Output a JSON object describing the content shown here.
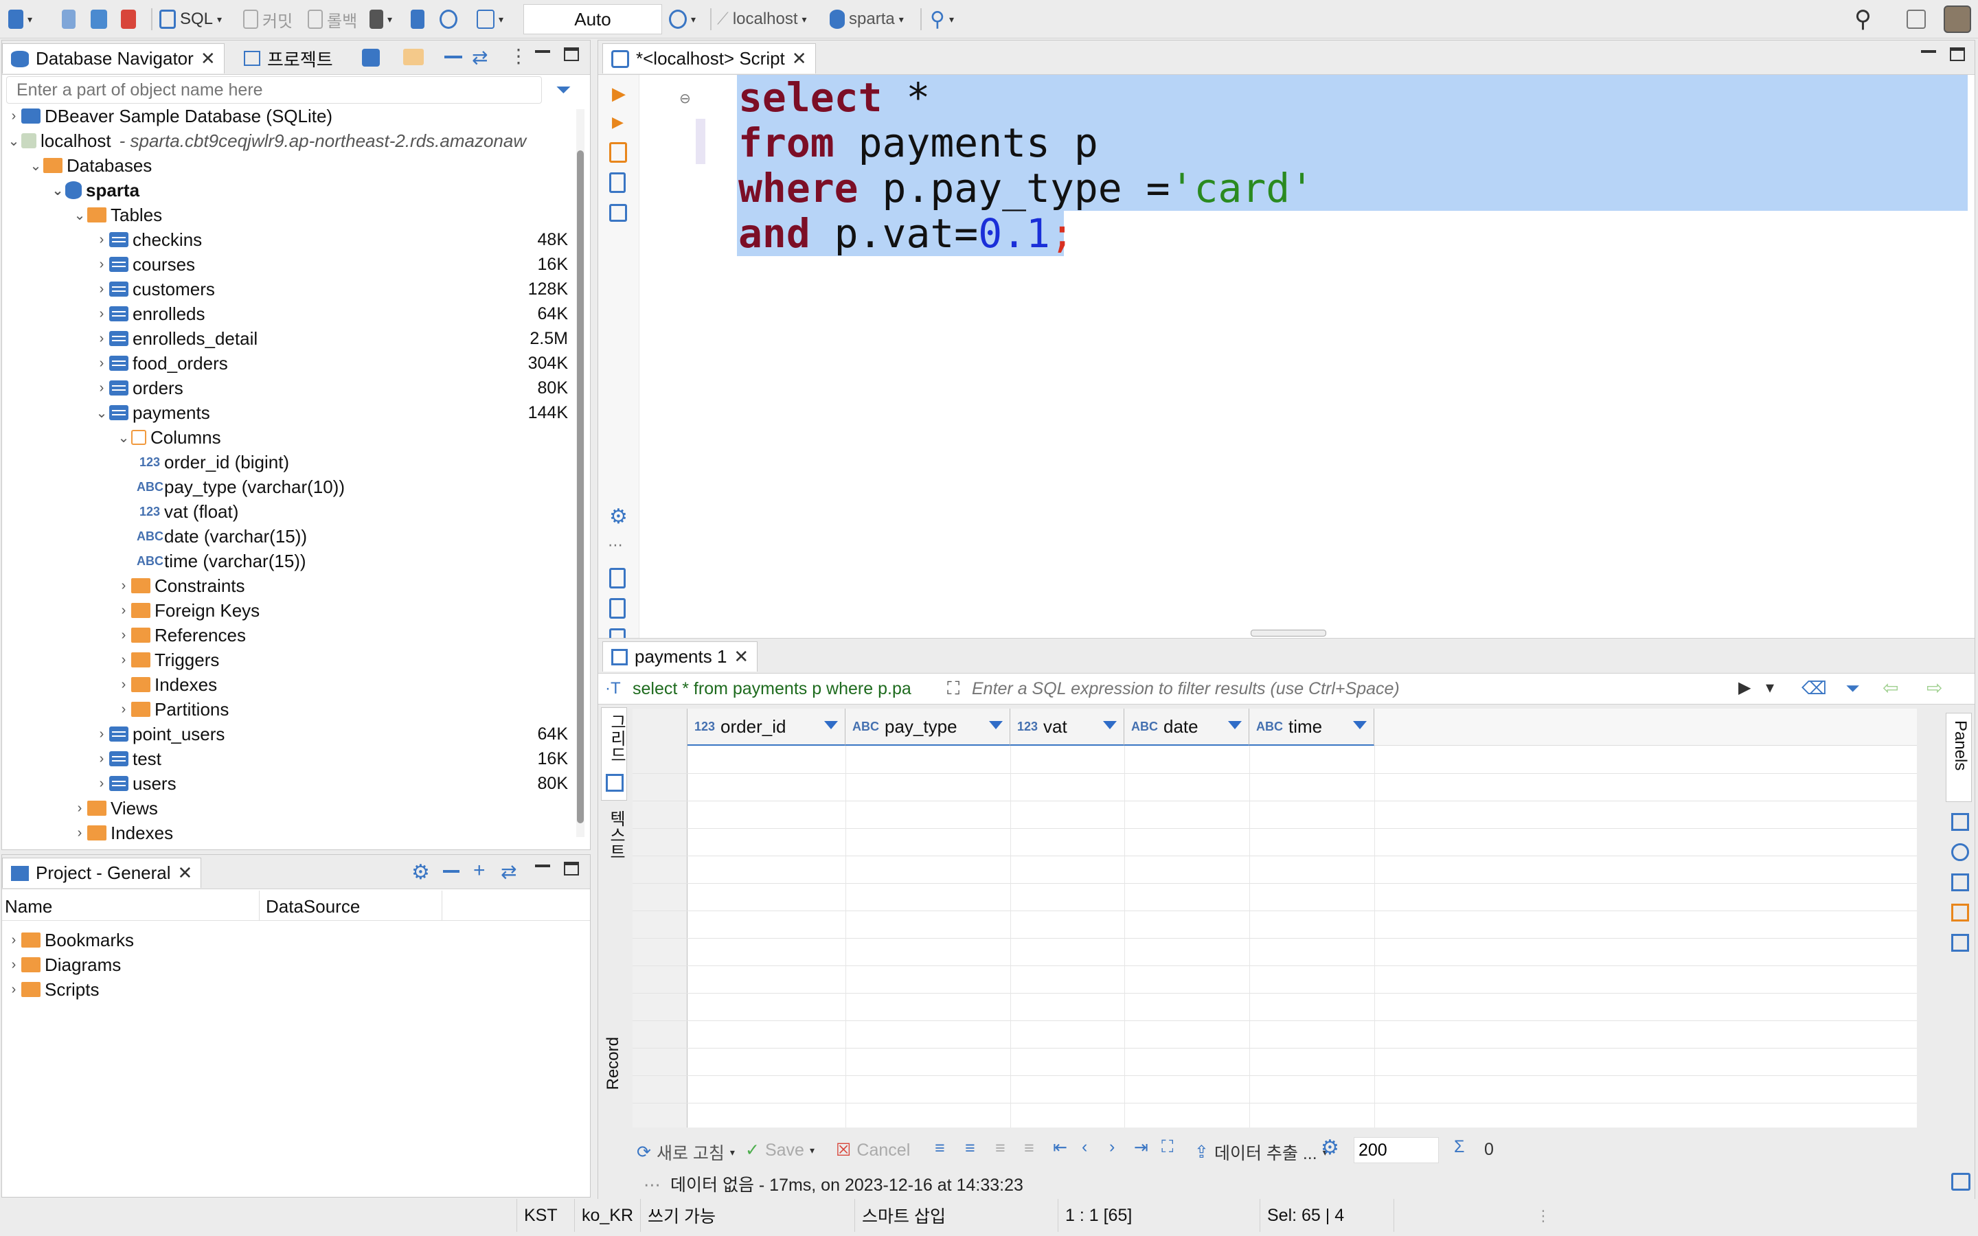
{
  "toolbar": {
    "sql_label": "SQL",
    "commit_label": "커밋",
    "rollback_label": "롤백",
    "tx_mode": "Auto",
    "connection": "localhost",
    "database": "sparta"
  },
  "navigator": {
    "tab_label": "Database Navigator",
    "project_tab_label": "프로젝트",
    "search_placeholder": "Enter a part of object name here",
    "tree": {
      "sample_db": "DBeaver Sample Database (SQLite)",
      "conn_name": "localhost",
      "conn_host": "- sparta.cbt9ceqjwlr9.ap-northeast-2.rds.amazonaw",
      "databases": "Databases",
      "db_name": "sparta",
      "tables": "Tables",
      "table_list": [
        {
          "name": "checkins",
          "size": "48K"
        },
        {
          "name": "courses",
          "size": "16K"
        },
        {
          "name": "customers",
          "size": "128K"
        },
        {
          "name": "enrolleds",
          "size": "64K"
        },
        {
          "name": "enrolleds_detail",
          "size": "2.5M"
        },
        {
          "name": "food_orders",
          "size": "304K"
        },
        {
          "name": "orders",
          "size": "80K"
        },
        {
          "name": "payments",
          "size": "144K"
        }
      ],
      "columns_label": "Columns",
      "columns": [
        {
          "type": "123",
          "label": "order_id (bigint)"
        },
        {
          "type": "ABC",
          "label": "pay_type (varchar(10))"
        },
        {
          "type": "123",
          "label": "vat (float)"
        },
        {
          "type": "ABC",
          "label": "date (varchar(15))"
        },
        {
          "type": "ABC",
          "label": "time (varchar(15))"
        }
      ],
      "folders": [
        "Constraints",
        "Foreign Keys",
        "References",
        "Triggers",
        "Indexes",
        "Partitions"
      ],
      "more_tables": [
        {
          "name": "point_users",
          "size": "64K"
        },
        {
          "name": "test",
          "size": "16K"
        },
        {
          "name": "users",
          "size": "80K"
        }
      ],
      "views": "Views",
      "indexes": "Indexes"
    }
  },
  "project": {
    "tab_label": "Project - General",
    "col_name": "Name",
    "col_datasource": "DataSource",
    "items": [
      "Bookmarks",
      "Diagrams",
      "Scripts"
    ]
  },
  "editor": {
    "tab_label": "*<localhost> Script",
    "code": {
      "l1_kw": "select",
      "l1_rest": " *",
      "l2_kw": "from",
      "l2_rest": " payments p",
      "l3_kw": "where",
      "l3_rest": " p.pay_type =",
      "l3_str": "'card'",
      "l4_kw": "and",
      "l4_rest": " p.vat=",
      "l4_num": "0.1",
      "l4_semi": ";"
    }
  },
  "results": {
    "tab_label": "payments 1",
    "query_preview": "select * from payments p where p.pa",
    "filter_placeholder": "Enter a SQL expression to filter results (use Ctrl+Space)",
    "side_grid": "그리드",
    "side_text": "텍스트",
    "side_record": "Record",
    "side_panels": "Panels",
    "columns": [
      {
        "type": "123",
        "name": "order_id"
      },
      {
        "type": "ABC",
        "name": "pay_type"
      },
      {
        "type": "123",
        "name": "vat"
      },
      {
        "type": "ABC",
        "name": "date"
      },
      {
        "type": "ABC",
        "name": "time"
      }
    ],
    "bottom": {
      "refresh": "새로 고침",
      "save": "Save",
      "cancel": "Cancel",
      "export": "데이터 추출 ...",
      "fetch_size": "200",
      "count": "0"
    },
    "message": "데이터 없음 - 17ms, on 2023-12-16 at 14:33:23"
  },
  "statusbar": {
    "tz": "KST",
    "locale": "ko_KR",
    "mode": "쓰기 가능",
    "insert": "스마트 삽입",
    "position": "1 : 1 [65]",
    "selection": "Sel: 65 | 4"
  }
}
